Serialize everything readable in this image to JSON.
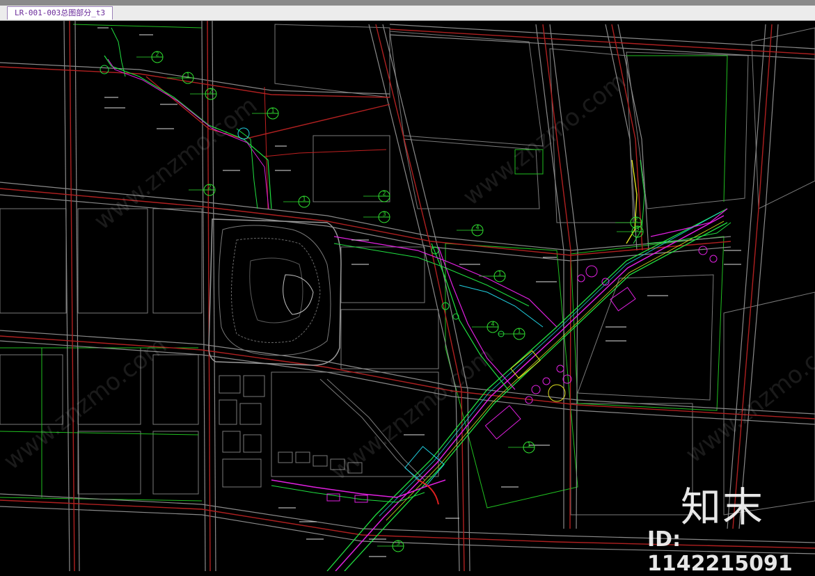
{
  "window": {
    "tab_label": "LR-001-003总图部分_t3"
  },
  "drawing": {
    "callouts": [
      {
        "num": "2"
      },
      {
        "num": "1"
      },
      {
        "num": "2"
      },
      {
        "num": "1"
      },
      {
        "num": "2"
      },
      {
        "num": "1"
      },
      {
        "num": "2"
      },
      {
        "num": "3"
      },
      {
        "num": "4"
      },
      {
        "num": "1"
      },
      {
        "num": "4"
      },
      {
        "num": "1"
      },
      {
        "num": "2"
      },
      {
        "num": "3"
      },
      {
        "num": "1"
      },
      {
        "num": "3"
      }
    ]
  },
  "watermark": {
    "text": "www.znzmo.com",
    "logo_text": "知末",
    "id_text": "ID: 1142215091"
  },
  "colors": {
    "background": "#000000",
    "road": "#b02020",
    "road_edge": "#8a8a8a",
    "green": "#30e030",
    "magenta": "#e020e0",
    "cyan": "#20d0e0",
    "yellow": "#e0e020"
  }
}
